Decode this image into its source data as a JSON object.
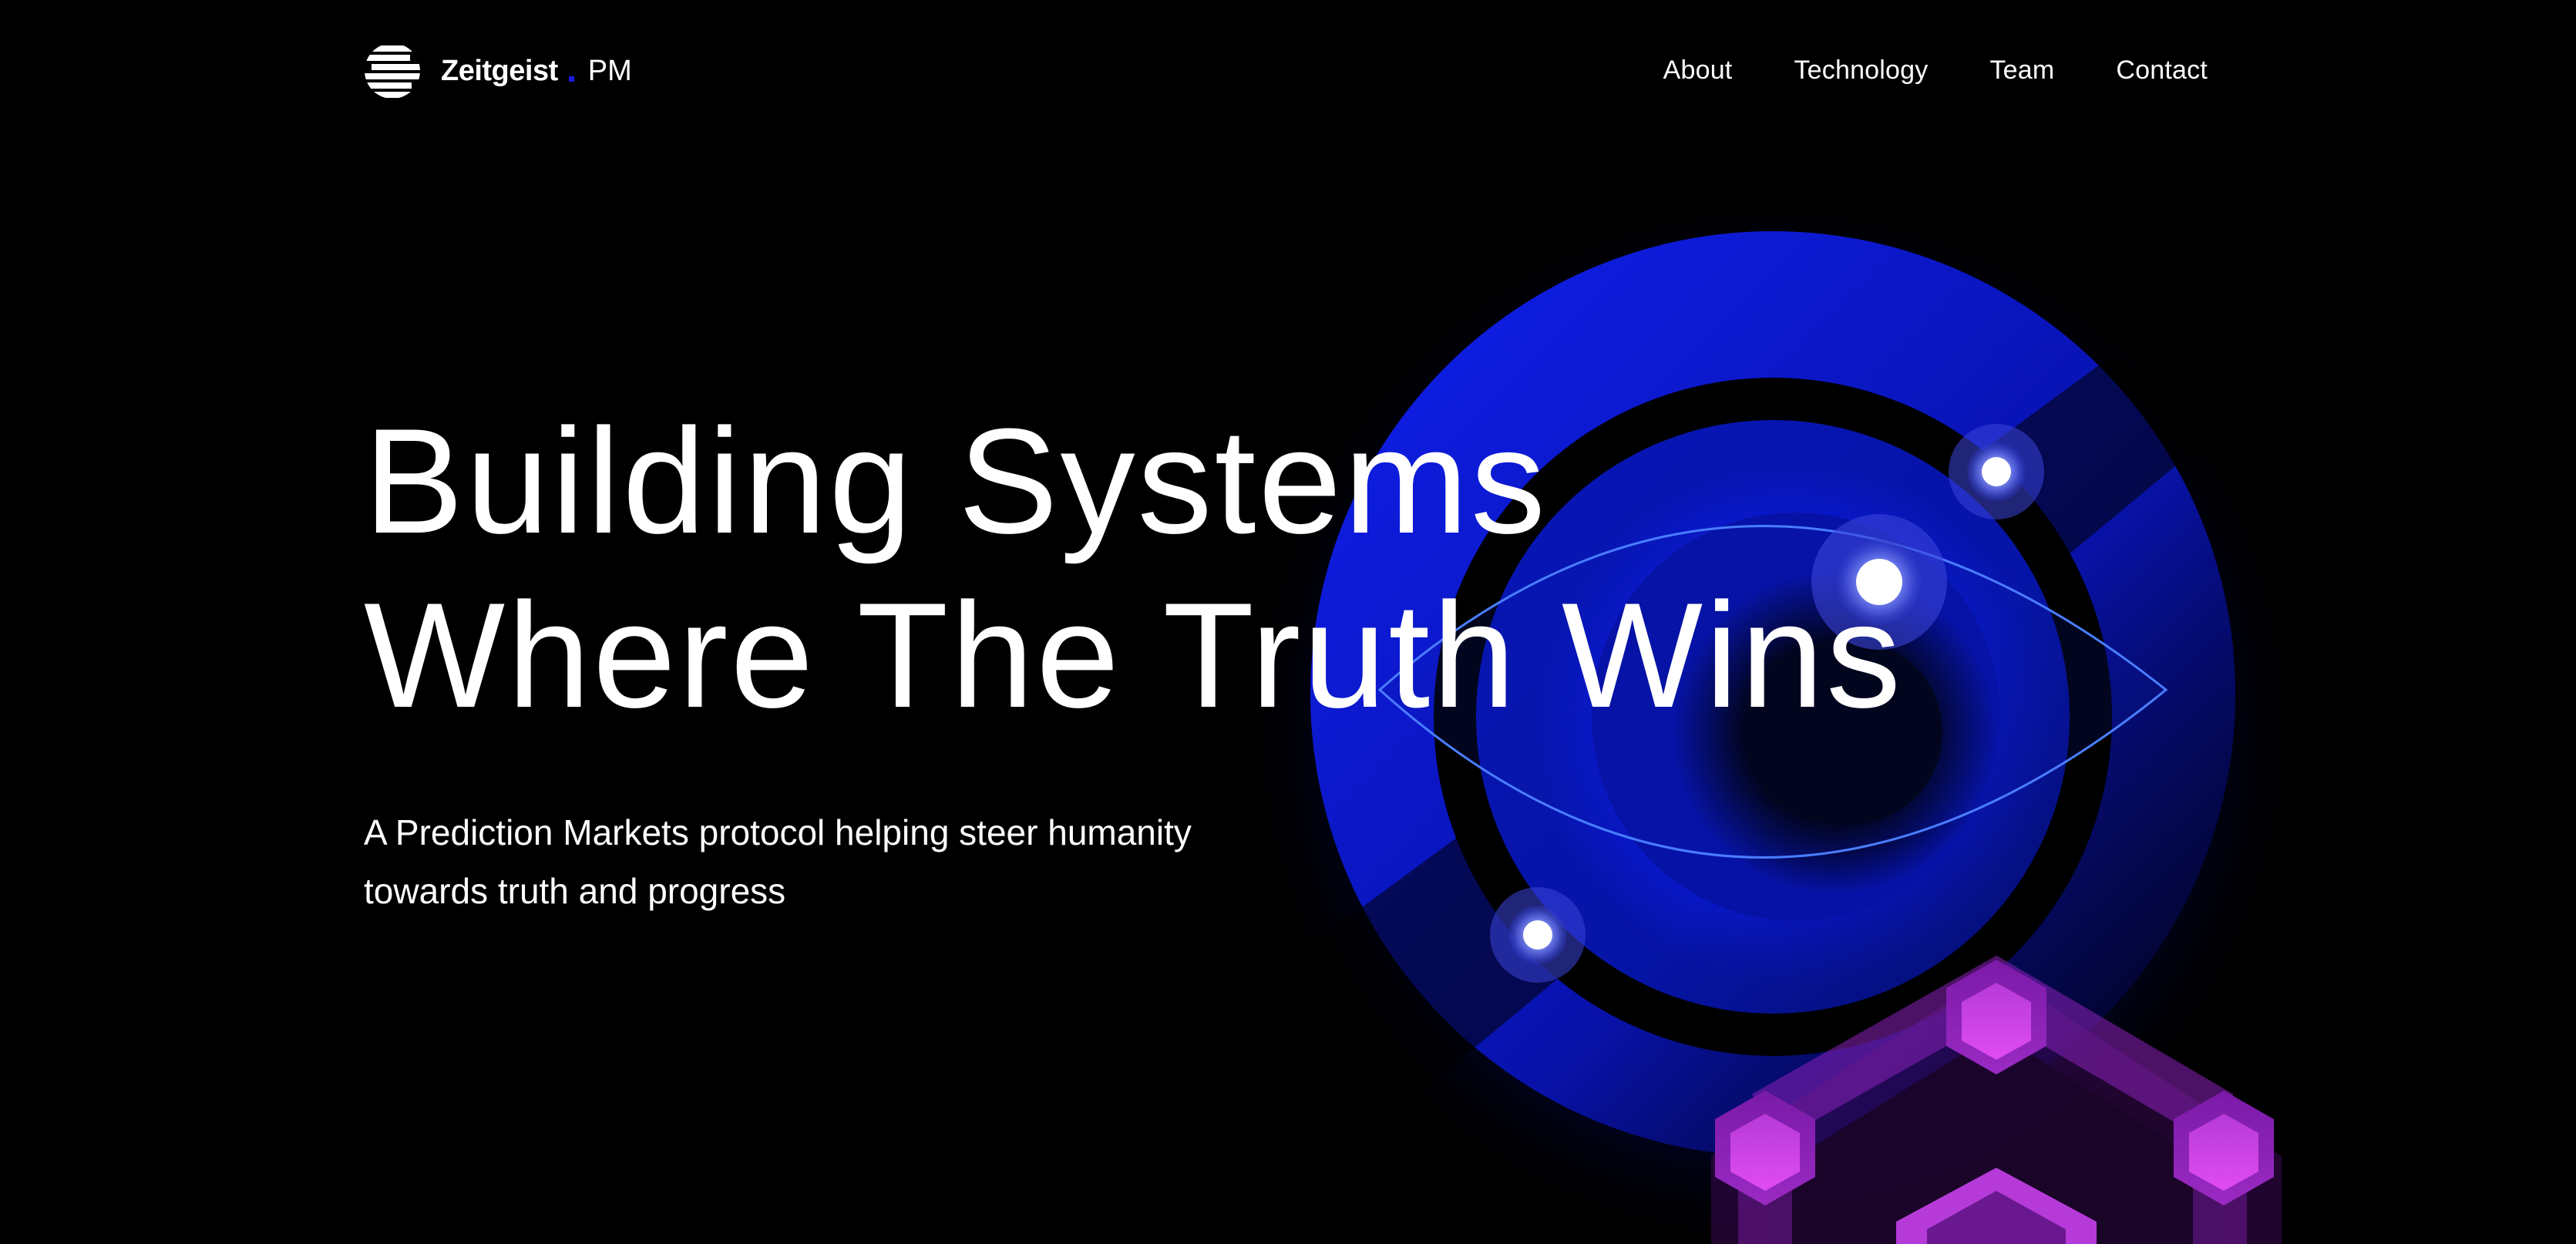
{
  "brand": {
    "name": "Zeitgeist",
    "suffix": "PM",
    "logo_icon": "striped-globe-logo",
    "accent": "#1a1adf"
  },
  "nav": {
    "links": [
      {
        "label": "About"
      },
      {
        "label": "Technology"
      },
      {
        "label": "Team"
      },
      {
        "label": "Contact"
      }
    ]
  },
  "hero": {
    "headline_line1": "Building Systems",
    "headline_line2": "Where The Truth Wins",
    "subtitle_line1": "A Prediction Markets protocol helping steer humanity",
    "subtitle_line2": "towards truth and progress",
    "art": "blue-eye-rings-with-purple-hexagon-network",
    "colors": {
      "background": "#000000",
      "ring_blue": "#0a14e6",
      "eye_outline": "#4a7dff",
      "hexagon_purple": "#c23ee0"
    }
  }
}
